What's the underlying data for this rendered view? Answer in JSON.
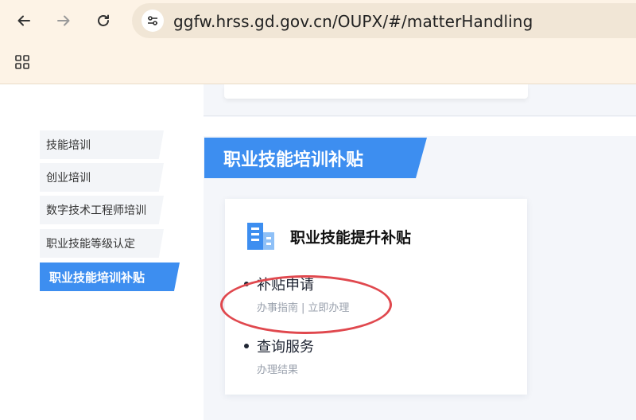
{
  "browser": {
    "url": "ggfw.hrss.gd.gov.cn/OUPX/#/matterHandling",
    "back_icon": "arrow-left-icon",
    "forward_icon": "arrow-right-icon",
    "reload_icon": "reload-icon",
    "site_info_icon": "tune-icon",
    "apps_icon": "apps-grid-icon"
  },
  "sidebar": {
    "items": [
      {
        "label": "技能培训",
        "active": false
      },
      {
        "label": "创业培训",
        "active": false
      },
      {
        "label": "数字技术工程师培训",
        "active": false
      },
      {
        "label": "职业技能等级认定",
        "active": false
      },
      {
        "label": "职业技能培训补贴",
        "active": true
      }
    ]
  },
  "section": {
    "title": "职业技能培训补贴"
  },
  "card": {
    "title": "职业技能提升补贴",
    "icon": "building-icon",
    "services": [
      {
        "name": "补贴申请",
        "links": [
          "办事指南",
          "立即办理"
        ]
      },
      {
        "name": "查询服务",
        "links": [
          "办理结果"
        ]
      }
    ],
    "separator": "|"
  },
  "colors": {
    "accent": "#3d8ef0",
    "annotation": "#e0484e",
    "chrome_bg": "#fdf3e6"
  }
}
